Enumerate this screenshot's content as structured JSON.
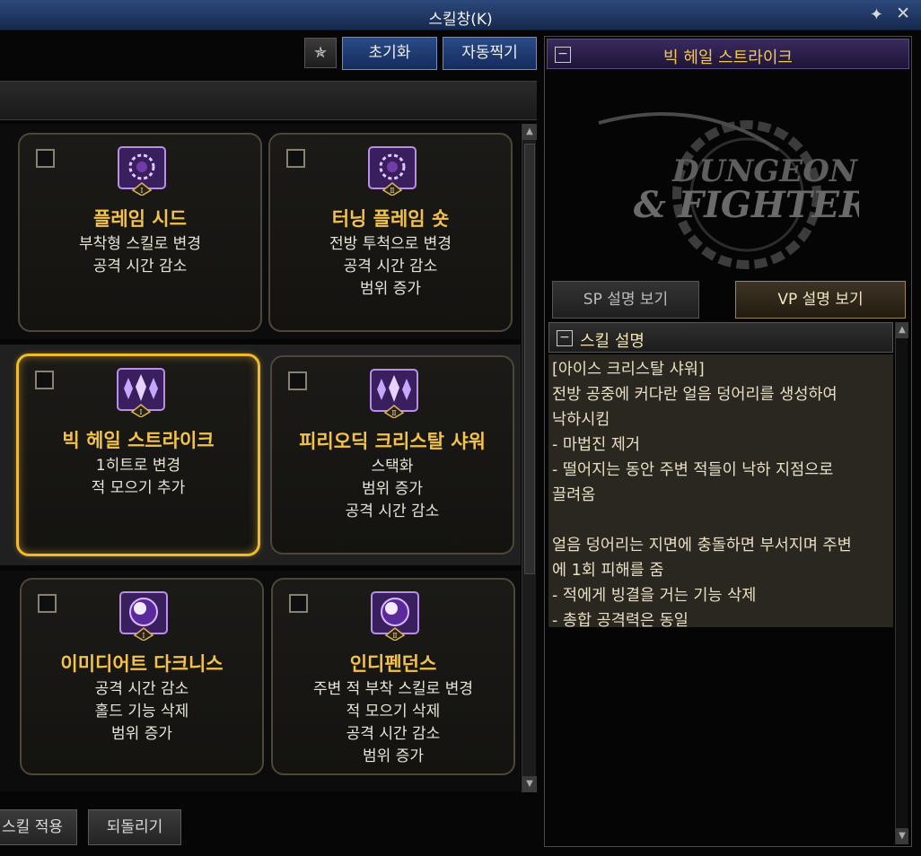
{
  "window": {
    "title": "스킬창(K)",
    "pin_icon": "pin-icon",
    "close_icon": "close-icon"
  },
  "toolbar": {
    "icon_button": "skill-slot-icon",
    "reset_label": "초기화",
    "auto_label": "자동찍기"
  },
  "cards": [
    {
      "name": "플레임 시드",
      "tier": "Ⅰ",
      "icon": "flame-seed-icon",
      "selected": false,
      "desc": [
        "부착형 스킬로 변경",
        "공격 시간 감소"
      ]
    },
    {
      "name": "터닝 플레임 숏",
      "tier": "Ⅱ",
      "icon": "turning-flame-icon",
      "selected": false,
      "desc": [
        "전방 투척으로 변경",
        "공격 시간 감소",
        "범위 증가"
      ]
    },
    {
      "name": "빅 헤일 스트라이크",
      "tier": "Ⅰ",
      "icon": "big-hail-icon",
      "selected": true,
      "desc": [
        "1히트로 변경",
        "적 모으기 추가"
      ]
    },
    {
      "name": "피리오딕 크리스탈 샤워",
      "tier": "Ⅱ",
      "icon": "crystal-shower-icon",
      "selected": false,
      "desc": [
        "스택화",
        "범위 증가",
        "공격 시간 감소"
      ]
    },
    {
      "name": "이미디어트 다크니스",
      "tier": "Ⅰ",
      "icon": "dark-orb-icon",
      "selected": false,
      "desc": [
        "공격 시간 감소",
        "홀드 기능 삭제",
        "범위 증가"
      ]
    },
    {
      "name": "인디펜던스",
      "tier": "Ⅱ",
      "icon": "independence-orb-icon",
      "selected": false,
      "desc": [
        "주변 적 부착 스킬로 변경",
        "적 모으기 삭제",
        "공격 시간 감소",
        "범위 증가"
      ]
    }
  ],
  "bottom": {
    "apply_label": "스킬 적용",
    "revert_label": "되돌리기"
  },
  "detail": {
    "title": "빅 헤일 스트라이크",
    "logo_text": [
      "DUNGEON",
      "& FIGHTER"
    ],
    "tab_sp": "SP 설명 보기",
    "tab_vp": "VP 설명 보기",
    "section_title": "스킬 설명",
    "lines": [
      "[아이스 크리스탈 샤워]",
      "전방 공중에 커다란 얼음 덩어리를 생성하여",
      "낙하시킴",
      " - 마법진 제거",
      " - 떨어지는 동안 주변 적들이 낙하 지점으로",
      "끌려옴",
      "",
      "얼음 덩어리는 지면에 충돌하면 부서지며 주변",
      "에 1회 피해를 줌",
      " - 적에게 빙결을 거는 기능 삭제",
      " - 총합 공격력은 동일"
    ]
  }
}
